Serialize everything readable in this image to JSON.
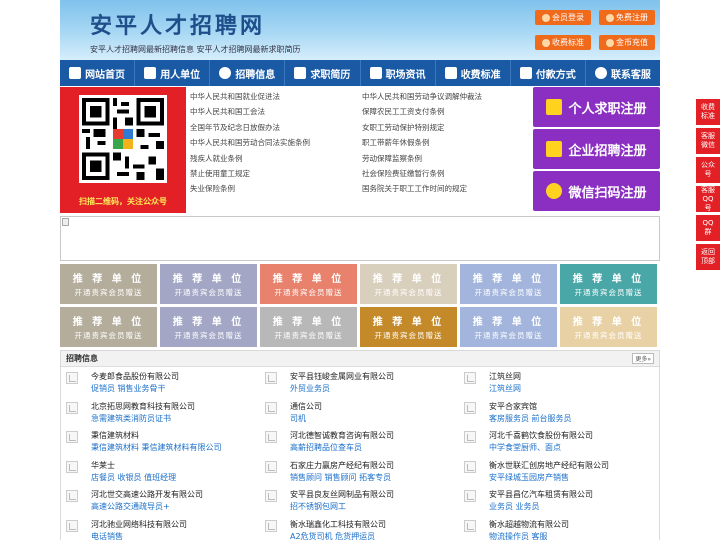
{
  "header": {
    "title": "安平人才招聘网",
    "subtitle": "安平人才招聘网最新招聘信息    安平人才招聘网最新求职简历",
    "buttons": [
      {
        "label": "会员登录"
      },
      {
        "label": "免费注册"
      },
      {
        "label": "收费标准"
      },
      {
        "label": "金币充值"
      }
    ]
  },
  "nav": [
    {
      "label": "网站首页",
      "icon": "home-icon"
    },
    {
      "label": "用人单位",
      "icon": "building-icon"
    },
    {
      "label": "招聘信息",
      "icon": "jobs-icon"
    },
    {
      "label": "求职简历",
      "icon": "resume-icon"
    },
    {
      "label": "职场资讯",
      "icon": "news-icon"
    },
    {
      "label": "收费标准",
      "icon": "fee-icon"
    },
    {
      "label": "付款方式",
      "icon": "payment-icon"
    },
    {
      "label": "联系客服",
      "icon": "phone-icon"
    }
  ],
  "qr": {
    "caption": "扫描二维码，关注公众号"
  },
  "law_links": [
    "中华人民共和国就业促进法",
    "中华人民共和国劳动争议调解仲裁法",
    "中华人民共和国工会法",
    "保障农民工工资支付条例",
    "全国年节及纪念日放假办法",
    "女职工劳动保护特别规定",
    "中华人民共和国劳动合同法实施条例",
    "职工带薪年休假条例",
    "残疾人就业条例",
    "劳动保障监察条例",
    "禁止使用童工规定",
    "社会保险费征缴暂行条例",
    "失业保险条例",
    "国务院关于职工工作时间的规定"
  ],
  "register": [
    {
      "label": "个人求职注册"
    },
    {
      "label": "企业招聘注册"
    },
    {
      "label": "微信扫码注册"
    }
  ],
  "promo": {
    "line1": "推 荐 单 位",
    "line2": "开通贵宾会员赠送",
    "colors": [
      "#b4ad9c",
      "#a3a7c5",
      "#e8826c",
      "#d9cfbd",
      "#a3b5dc",
      "#4aa7a8",
      "#b4ad9c",
      "#a3a7c5",
      "#b8b8b8",
      "#c48a2a",
      "#a3b5dc",
      "#e8d2a5"
    ]
  },
  "jobs": {
    "title": "招聘信息",
    "more": "更多»",
    "items": [
      {
        "company": "今麦郎食品股份有限公司",
        "positions": "促销员 销售业务骨干"
      },
      {
        "company": "安平县钰峻金属网业有限公司",
        "positions": "外贸业务员"
      },
      {
        "company": "江筑丝网",
        "positions": "江筑丝网"
      },
      {
        "company": "北京拓思网教育科技有限公司",
        "positions": "急需建筑类消防员证书"
      },
      {
        "company": "通信公司",
        "positions": "司机"
      },
      {
        "company": "安平合家宾馆",
        "positions": "客房服务员 前台服务员"
      },
      {
        "company": "秉信建筑材料",
        "positions": "秉信建筑材料 秉信建筑材料有限公司"
      },
      {
        "company": "河北德智诚教育咨询有限公司",
        "positions": "高薪招聘品位查车员"
      },
      {
        "company": "河北千喜鹤饮食股份有限公司",
        "positions": "中学食堂厨师、面点"
      },
      {
        "company": "华莱士",
        "positions": "店餐员 收银员 值班经理"
      },
      {
        "company": "石家庄力赢房产经纪有限公司",
        "positions": "销售顾问 销售顾问 拓客专员"
      },
      {
        "company": "衡水世联汇创房地产经纪有限公司",
        "positions": "安平绿城玉园房产销售"
      },
      {
        "company": "河北世交高速公路开发有限公司",
        "positions": "高速公路交通疏导员+"
      },
      {
        "company": "安平县良友丝网制品有限公司",
        "positions": "招不锈钢包网工"
      },
      {
        "company": "安平县昌亿汽车租赁有限公司",
        "positions": "业务员 业务员"
      },
      {
        "company": "河北驰业网络科技有限公司",
        "positions": "电话销售"
      },
      {
        "company": "衡水瑞鑫化工科技有限公司",
        "positions": "A2危货司机 危货押运员"
      },
      {
        "company": "衡水超越物流有限公司",
        "positions": "物流操作员 客服"
      }
    ]
  },
  "sidebar": [
    {
      "label": "收费标准"
    },
    {
      "label": "客服微信"
    },
    {
      "label": "公众号"
    },
    {
      "label": "客服QQ号"
    },
    {
      "label": "QQ群"
    },
    {
      "label": "返回顶部"
    }
  ],
  "colors": {
    "nav_bg": "#1a5aa4",
    "header_button": "#f06a1c",
    "register_button": "#8a2fc1",
    "accent_red": "#e32025",
    "link_blue": "#1a6fc9"
  }
}
